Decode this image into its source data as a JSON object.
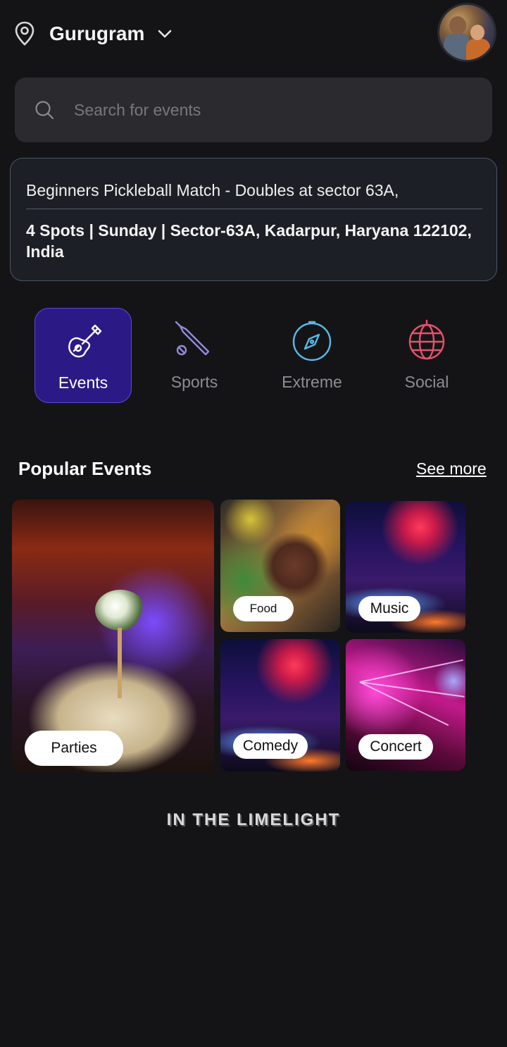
{
  "header": {
    "location": "Gurugram",
    "location_icon": "map-pin-icon",
    "dropdown_icon": "chevron-down-icon",
    "avatar_icon": "profile-avatar"
  },
  "search": {
    "placeholder": "Search for events",
    "icon": "search-icon"
  },
  "event_card": {
    "title": "Beginners Pickleball Match - Doubles at sector 63A,",
    "details": "4 Spots | Sunday | Sector-63A, Kadarpur, Haryana 122102, India"
  },
  "categories": [
    {
      "label": "Events",
      "icon": "guitar-icon",
      "active": true
    },
    {
      "label": "Sports",
      "icon": "cricket-bat-icon",
      "active": false
    },
    {
      "label": "Extreme",
      "icon": "compass-icon",
      "active": false
    },
    {
      "label": "Social",
      "icon": "disco-ball-icon",
      "active": false
    }
  ],
  "popular": {
    "title": "Popular Events",
    "see_more": "See more",
    "tiles": [
      {
        "label": "Parties"
      },
      {
        "label": "Food"
      },
      {
        "label": "Music"
      },
      {
        "label": "Comedy"
      },
      {
        "label": "Concert"
      }
    ]
  },
  "limelight": {
    "title": "IN THE LIMELIGHT"
  },
  "colors": {
    "background": "#141416",
    "active_category": "#2b1a86",
    "sports_icon": "#8f8ad6",
    "extreme_icon": "#5ab8e8",
    "social_icon": "#e8506e"
  }
}
